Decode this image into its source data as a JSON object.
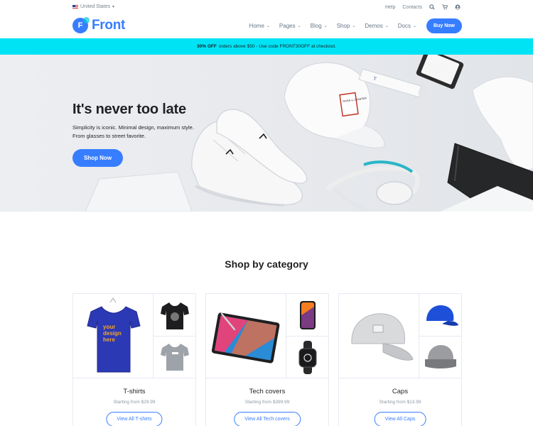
{
  "topbar": {
    "locale": "United States",
    "links": [
      "Help",
      "Contacts"
    ]
  },
  "brand": {
    "name": "Front",
    "mark": "F"
  },
  "nav": {
    "items": [
      "Home",
      "Pages",
      "Blog",
      "Shop",
      "Demos",
      "Docs"
    ],
    "cta": "Buy Now"
  },
  "promo": {
    "highlight": "30% OFF",
    "text": "orders above $50 - Use code FRONT30OFF at checkout."
  },
  "hero": {
    "title": "It's never too late",
    "line1": "Simplicity is iconic. Minimal design, maximum style.",
    "line2": "From glasses to street favorite.",
    "cta": "Shop Now",
    "cap_tag": "PAPER & CHANTIER"
  },
  "categories": {
    "title": "Shop by category",
    "items": [
      {
        "name": "T-shirts",
        "price": "Starting from $29.99",
        "cta": "View All T-shirts",
        "tee_print": [
          "your",
          "design",
          "here"
        ]
      },
      {
        "name": "Tech covers",
        "price": "Starting from $399.99",
        "cta": "View All Tech covers"
      },
      {
        "name": "Caps",
        "price": "Starting from $13.99",
        "cta": "View All Caps"
      }
    ]
  },
  "colors": {
    "primary": "#377dff",
    "promo_bg": "#00e3f5",
    "text": "#1e2022",
    "muted": "#8c98a4"
  }
}
